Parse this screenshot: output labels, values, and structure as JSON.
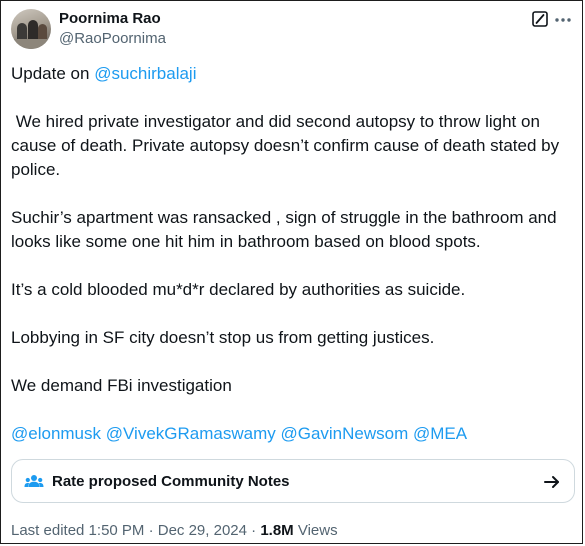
{
  "author": {
    "name": "Poornima Rao",
    "handle": "@RaoPoornima",
    "avatar": "avatar-photo"
  },
  "header_icons": {
    "edit": "edit-history-icon",
    "more": "more-options-icon"
  },
  "tweet": {
    "intro_text": "Update on ",
    "intro_mention": "@suchirbalaji",
    "para1": " We hired private investigator and did second autopsy to throw light on cause of death. Private autopsy doesn’t confirm cause of death stated by police.",
    "para2": "Suchir’s apartment was ransacked , sign of struggle in the bathroom and looks like some one hit him in bathroom based on blood spots.",
    "para3": "It’s a cold blooded mu*d*r declared by authorities as suicide.",
    "para4": "Lobbying in SF city doesn’t stop us from getting justices.",
    "para5": "We demand FBi investigation",
    "mentions": [
      "@elonmusk",
      "@VivekGRamaswamy",
      "@GavinNewsom",
      "@MEA"
    ]
  },
  "community_notes": {
    "label": "Rate proposed Community Notes",
    "icon": "people-icon",
    "arrow": "arrow-right-icon"
  },
  "meta": {
    "edited": "Last edited 1:50 PM · Dec 29, 2024 · ",
    "views_count": "1.8M",
    "views_label": " Views"
  },
  "colors": {
    "link": "#1d9bf0",
    "text": "#0f1419",
    "secondary": "#536471",
    "border": "#cfd9de"
  }
}
